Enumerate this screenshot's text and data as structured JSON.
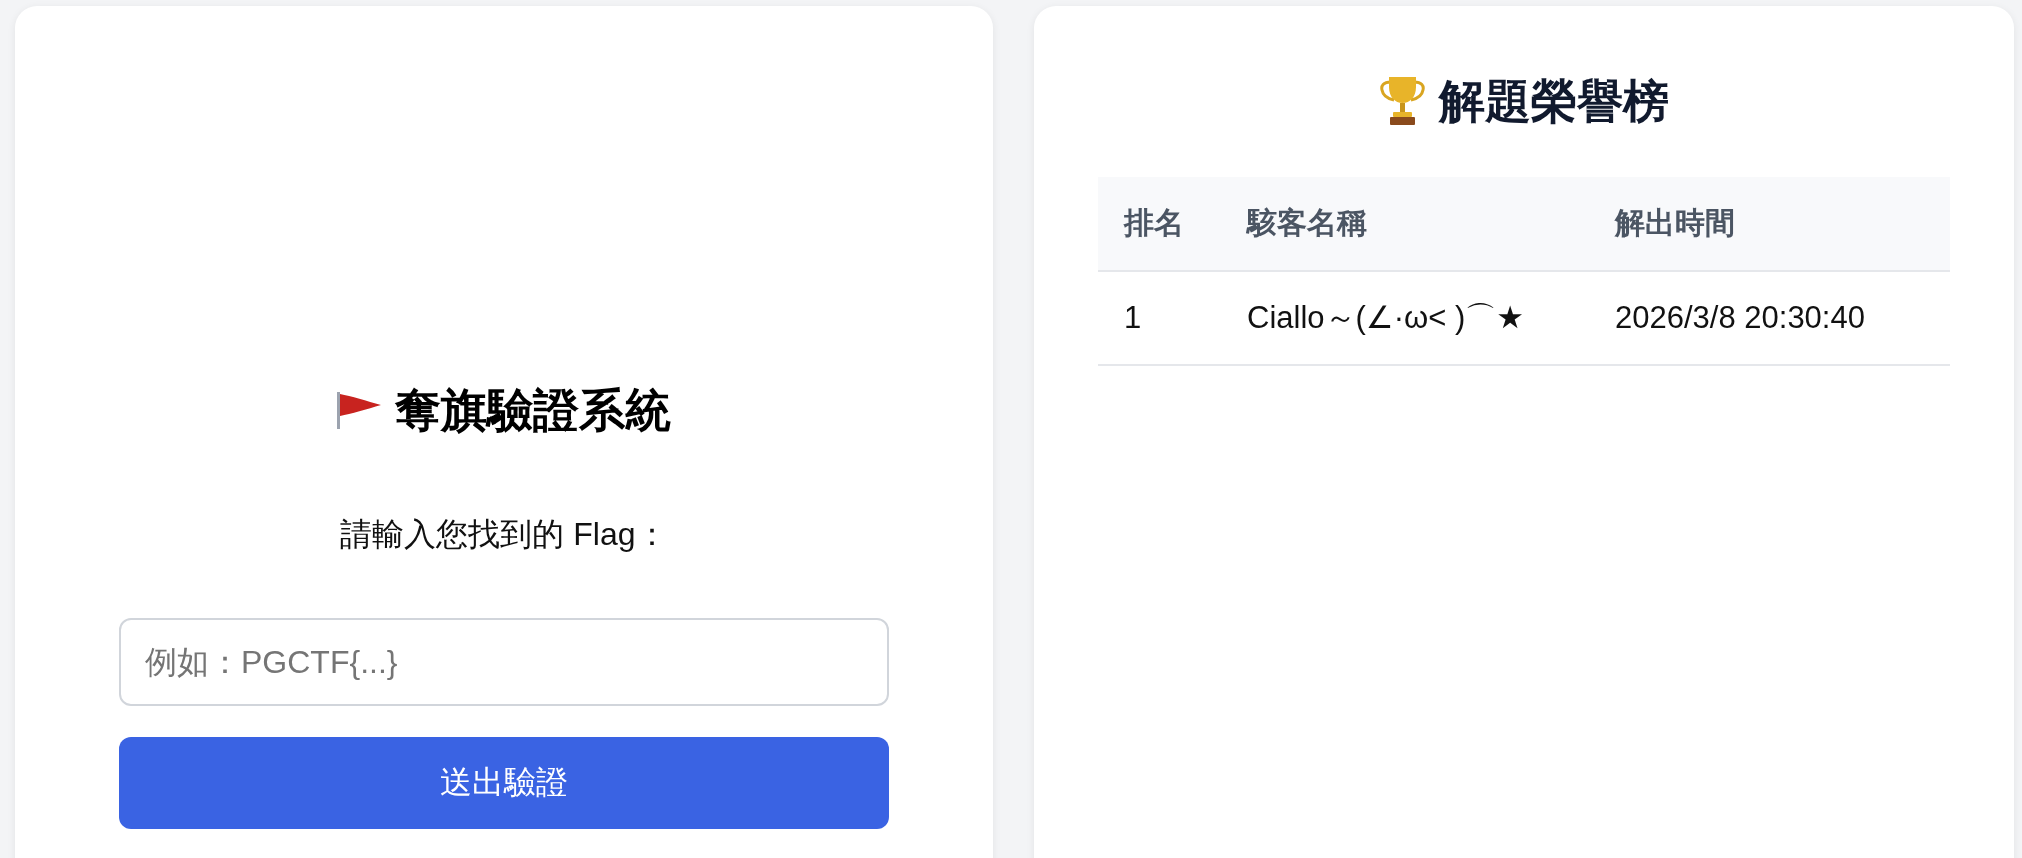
{
  "flag_panel": {
    "title": "奪旗驗證系統",
    "prompt": "請輸入您找到的 Flag：",
    "flag_input": {
      "placeholder": "例如：PGCTF{...}"
    },
    "submit_button": "送出驗證"
  },
  "leaderboard": {
    "title": "解題榮譽榜",
    "columns": [
      "排名",
      "駭客名稱",
      "解出時間"
    ],
    "rows": [
      [
        "1",
        "Ciallo～(∠·ω< )⌒★",
        "2026/3/8 20:30:40"
      ]
    ]
  }
}
